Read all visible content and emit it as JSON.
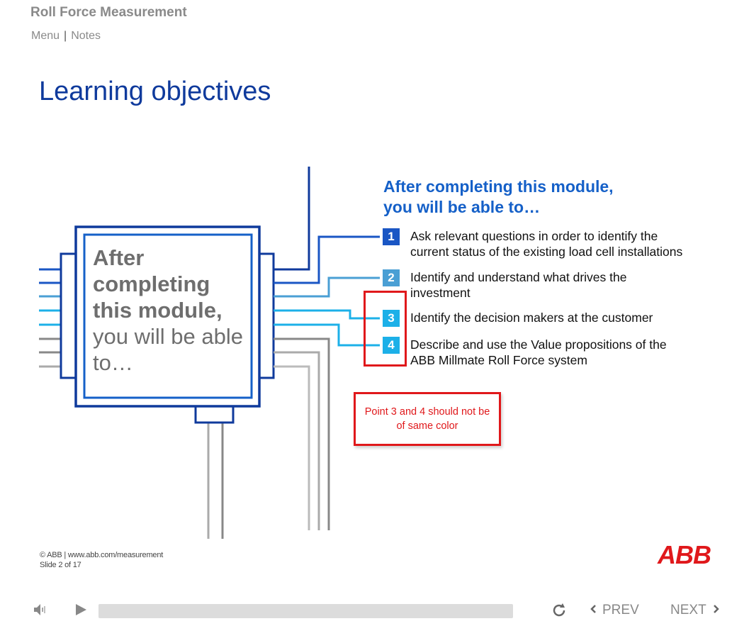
{
  "header": {
    "course_title": "Roll Force Measurement",
    "nav": {
      "menu": "Menu",
      "separator": "|",
      "notes": "Notes"
    }
  },
  "slide": {
    "heading": "Learning objectives",
    "chip_text": {
      "bold_line": "After completing this module,",
      "normal_line": "you will be able to…"
    },
    "objectives_heading_line1": "After completing this module,",
    "objectives_heading_line2": "you will be able to…",
    "objectives": [
      {
        "num": "1",
        "line1": "Ask relevant questions in order to identify the",
        "line2": "current status of the existing load cell installations",
        "color": "#1a56c4"
      },
      {
        "num": "2",
        "line1": "Identify and understand what drives the",
        "line2": "investment",
        "color": "#4a9fd4"
      },
      {
        "num": "3",
        "line1": "Identify the decision makers at the customer",
        "line2": "",
        "color": "#1cb0e8"
      },
      {
        "num": "4",
        "line1": "Describe and use the Value propositions of the",
        "line2": "ABB Millmate Roll Force system",
        "color": "#1cb0e8"
      }
    ],
    "callout": "Point 3 and 4 should not be of same color"
  },
  "footer": {
    "copyright": "© ABB | www.abb.com/measurement",
    "slide_counter": "Slide 2 of 17",
    "logo": "ABB"
  },
  "player": {
    "volume_icon": "speaker-icon",
    "play_icon": "play-icon",
    "replay_icon": "replay-icon",
    "prev_label": "PREV",
    "next_label": "NEXT",
    "progress": 0
  },
  "colors": {
    "dark_blue": "#0f3a9c",
    "mid_blue": "#1560c8",
    "light_blue": "#1cb0e8",
    "grey": "#8a8a8a",
    "red": "#e0181b"
  }
}
